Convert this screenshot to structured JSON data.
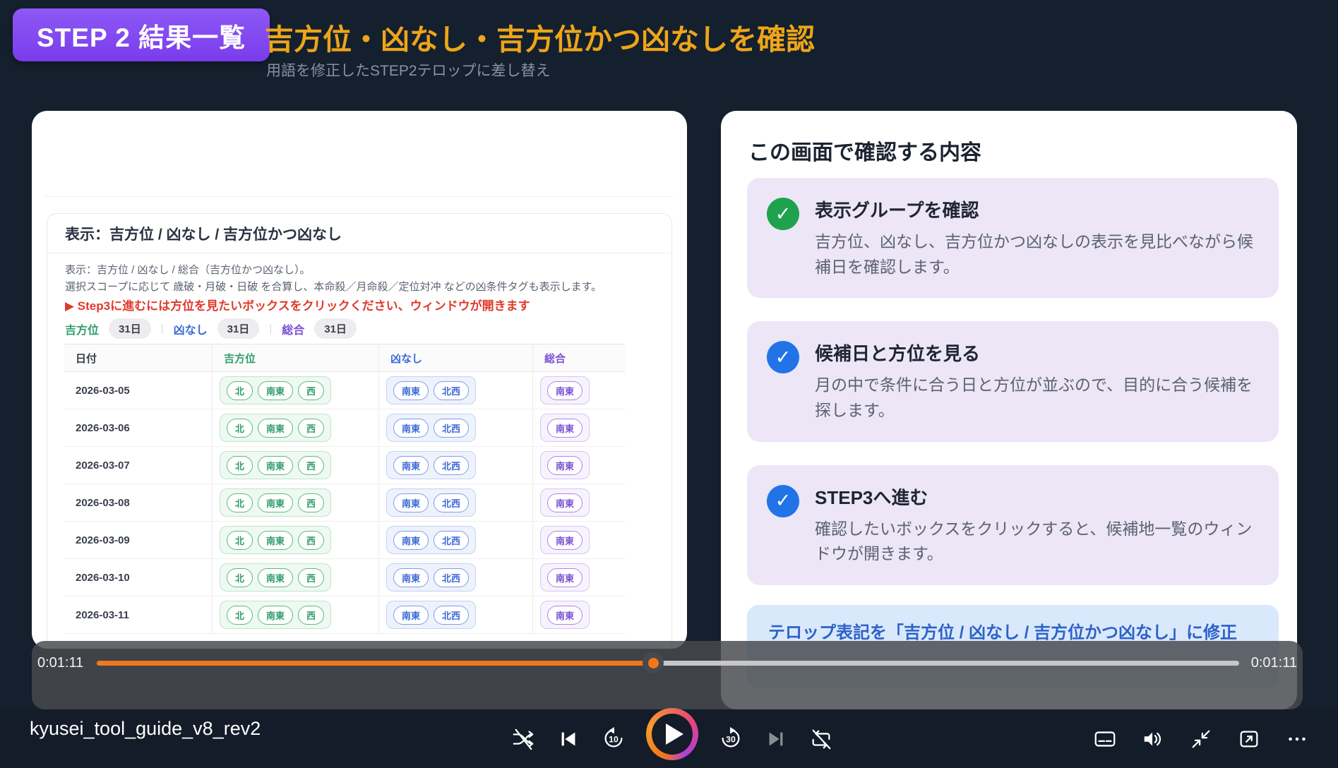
{
  "colors": {
    "accent_orange": "#f2761b",
    "badge_purple": "#7c3aed",
    "title_orange": "#eda519",
    "green": "#2f9d6e",
    "blue": "#3b68d8",
    "purple": "#7c4fd4",
    "red": "#e0392b",
    "check_green": "#1fa24e",
    "check_blue": "#2273e8"
  },
  "header": {
    "badge": "STEP 2 結果一覧",
    "title": "吉方位・凶なし・吉方位かつ凶なしを確認",
    "subtitle": "用語を修正したSTEP2テロップに差し替え"
  },
  "screen": {
    "panel_title": "表示：吉方位 / 凶なし / 吉方位かつ凶なし",
    "desc_line1": "表示：吉方位 / 凶なし / 総合（吉方位かつ凶なし）。",
    "desc_line2": "選択スコープに応じて 歳破・月破・日破 を合算し、本命殺／月命殺／定位対冲 などの凶条件タグも表示します。",
    "cta": "▶ Step3に進むには方位を見たいボックスをクリックください、ウィンドウが開きます",
    "counts": [
      {
        "label": "吉方位",
        "value": "31日",
        "tone": "green"
      },
      {
        "label": "凶なし",
        "value": "31日",
        "tone": "blue"
      },
      {
        "label": "総合",
        "value": "31日",
        "tone": "purple"
      }
    ],
    "table": {
      "headers": [
        {
          "label": "日付",
          "tone": "dark"
        },
        {
          "label": "吉方位",
          "tone": "green"
        },
        {
          "label": "凶なし",
          "tone": "blue"
        },
        {
          "label": "総合",
          "tone": "purple"
        }
      ],
      "rows": [
        {
          "date": "2026-03-05",
          "good": [
            "北",
            "南東",
            "西"
          ],
          "nobad": [
            "南東",
            "北西"
          ],
          "total": [
            "南東"
          ]
        },
        {
          "date": "2026-03-06",
          "good": [
            "北",
            "南東",
            "西"
          ],
          "nobad": [
            "南東",
            "北西"
          ],
          "total": [
            "南東"
          ]
        },
        {
          "date": "2026-03-07",
          "good": [
            "北",
            "南東",
            "西"
          ],
          "nobad": [
            "南東",
            "北西"
          ],
          "total": [
            "南東"
          ]
        },
        {
          "date": "2026-03-08",
          "good": [
            "北",
            "南東",
            "西"
          ],
          "nobad": [
            "南東",
            "北西"
          ],
          "total": [
            "南東"
          ]
        },
        {
          "date": "2026-03-09",
          "good": [
            "北",
            "南東",
            "西"
          ],
          "nobad": [
            "南東",
            "北西"
          ],
          "total": [
            "南東"
          ]
        },
        {
          "date": "2026-03-10",
          "good": [
            "北",
            "南東",
            "西"
          ],
          "nobad": [
            "南東",
            "北西"
          ],
          "total": [
            "南東"
          ]
        },
        {
          "date": "2026-03-11",
          "good": [
            "北",
            "南東",
            "西"
          ],
          "nobad": [
            "南東",
            "北西"
          ],
          "total": [
            "南東"
          ]
        }
      ]
    }
  },
  "checklist": {
    "title": "この画面で確認する内容",
    "items": [
      {
        "tone": "green",
        "title": "表示グループを確認",
        "body": "吉方位、凶なし、吉方位かつ凶なしの表示を見比べながら候補日を確認します。"
      },
      {
        "tone": "blue",
        "title": "候補日と方位を見る",
        "body": "月の中で条件に合う日と方位が並ぶので、目的に合う候補を探します。"
      },
      {
        "tone": "blue",
        "title": "STEP3へ進む",
        "body": "確認したいボックスをクリックすると、候補地一覧のウィンドウが開きます。"
      }
    ],
    "note": "テロップ表記を「吉方位 / 凶なし / 吉方位かつ凶なし」に修正"
  },
  "player": {
    "filename": "kyusei_tool_guide_v8_rev2",
    "elapsed": "0:01:11",
    "duration": "0:01:11",
    "progress_percent": 48.7,
    "skip_back": "10",
    "skip_forward": "30"
  }
}
